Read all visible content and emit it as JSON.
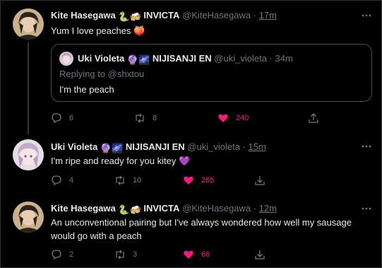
{
  "tweets": [
    {
      "name": "Kite Hasegawa",
      "badges": [
        "🐍",
        "🍻"
      ],
      "affiliation": "INVICTA",
      "handle": "@KiteHasegawa",
      "time": "17m",
      "text": "Yum I love peaches 🍑",
      "quote": {
        "name": "Uki Violeta",
        "badges": [
          "🔮",
          "🌌"
        ],
        "affiliation": "NIJISANJI EN",
        "handle": "@uki_violeta",
        "time": "34m",
        "reply_prefix": "Replying to ",
        "reply_to": "@shxtou",
        "text": "I'm the peach"
      },
      "replies": "6",
      "retweets": "8",
      "likes": "240",
      "liked": true
    },
    {
      "name": "Uki Violeta",
      "badges": [
        "🔮",
        "🌌"
      ],
      "affiliation": "NIJISANJI EN",
      "handle": "@uki_violeta",
      "time": "15m",
      "text": "I'm ripe and ready for you kitey 💜",
      "replies": "4",
      "retweets": "10",
      "likes": "265",
      "liked": true
    },
    {
      "name": "Kite Hasegawa",
      "badges": [
        "🐍",
        "🍻"
      ],
      "affiliation": "INVICTA",
      "handle": "@KiteHasegawa",
      "time": "12m",
      "text_line1": "An unconventional pairing but I've always wondered how well my sausage",
      "text_line2": "would go with a peach",
      "replies": "2",
      "retweets": "3",
      "likes": "66",
      "liked": true
    }
  ],
  "separator": "·",
  "icons": [
    "reply-icon",
    "retweet-icon",
    "heart-icon",
    "share-icon",
    "more-icon"
  ],
  "colors": {
    "background": "#000000",
    "text": "#e7e9ea",
    "muted": "#71767b",
    "like": "#f91880",
    "border": "#2f3336"
  }
}
